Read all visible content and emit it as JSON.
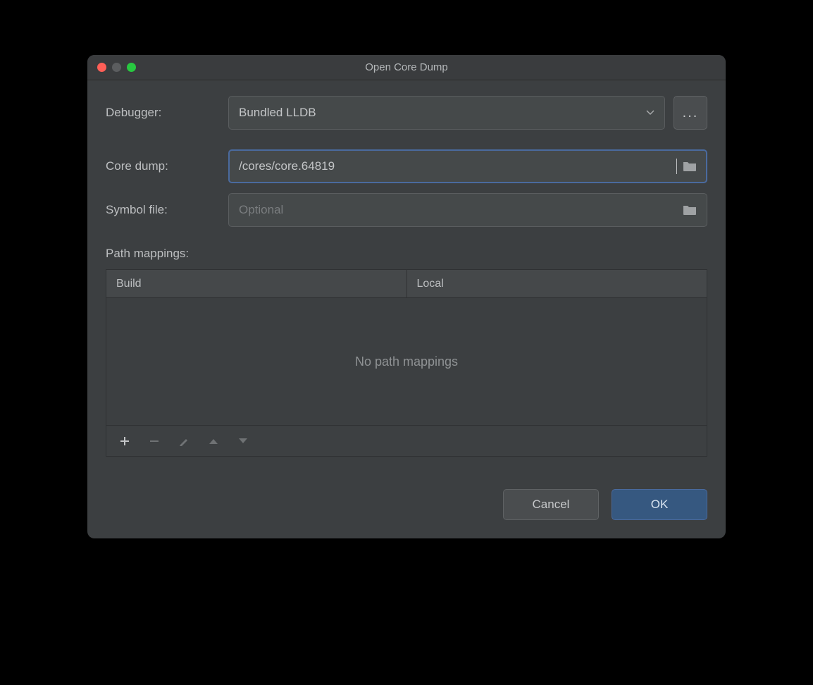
{
  "window": {
    "title": "Open Core Dump"
  },
  "labels": {
    "debugger": "Debugger:",
    "core_dump": "Core dump:",
    "symbol_file": "Symbol file:",
    "path_mappings": "Path mappings:"
  },
  "debugger": {
    "selected": "Bundled LLDB",
    "more_btn": "..."
  },
  "core_dump": {
    "value": "/cores/core.64819"
  },
  "symbol_file": {
    "value": "",
    "placeholder": "Optional"
  },
  "table": {
    "columns": [
      "Build",
      "Local"
    ],
    "empty_text": "No path mappings"
  },
  "footer": {
    "cancel": "Cancel",
    "ok": "OK"
  }
}
